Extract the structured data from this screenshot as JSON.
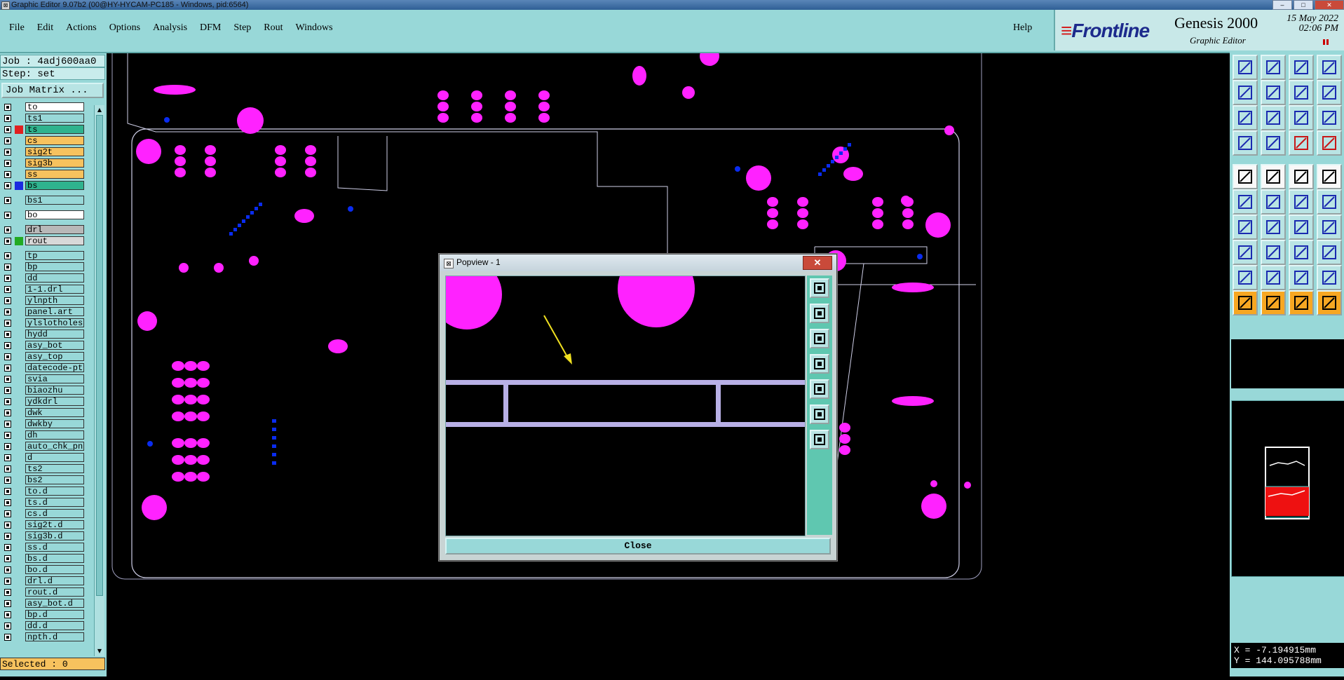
{
  "window": {
    "title": "Graphic Editor 9.07b2 (00@HY-HYCAM-PC185 - Windows, pid:6564)",
    "controls": [
      "–",
      "□",
      "✕"
    ]
  },
  "menu": {
    "items": [
      "File",
      "Edit",
      "Actions",
      "Options",
      "Analysis",
      "DFM",
      "Step",
      "Rout",
      "Windows"
    ],
    "help": "Help"
  },
  "brand": {
    "logo": "Frontline",
    "product": "Genesis 2000",
    "subtitle": "Graphic Editor",
    "date": "15 May 2022",
    "time": "02:06 PM"
  },
  "left": {
    "job": "Job : 4adj600aa0",
    "step": "Step: set",
    "job_matrix": "Job Matrix ...",
    "selected": "Selected : 0",
    "layers": [
      {
        "name": "to",
        "color": "",
        "bg": "#ffffff"
      },
      {
        "name": "ts1",
        "color": "",
        "bg": "#98d8d8"
      },
      {
        "name": "ts",
        "color": "#e02020",
        "bg": "#2fb38e"
      },
      {
        "name": "cs",
        "color": "",
        "bg": "#f7c25e"
      },
      {
        "name": "sig2t",
        "color": "",
        "bg": "#f7c25e"
      },
      {
        "name": "sig3b",
        "color": "",
        "bg": "#f7c25e"
      },
      {
        "name": "ss",
        "color": "",
        "bg": "#f7c25e"
      },
      {
        "name": "bs",
        "color": "#1a2ae0",
        "bg": "#2fb38e"
      },
      {
        "name": "bs1",
        "color": "",
        "bg": "#98d8d8"
      },
      {
        "name": "bo",
        "color": "",
        "bg": "#ffffff"
      },
      {
        "name": "drl",
        "color": "",
        "bg": "#b8b8b8"
      },
      {
        "name": "rout",
        "color": "#22aa22",
        "bg": "#d8d8d8"
      },
      {
        "name": "tp",
        "color": "",
        "bg": "#98d8d8"
      },
      {
        "name": "bp",
        "color": "",
        "bg": "#98d8d8"
      },
      {
        "name": "dd",
        "color": "",
        "bg": "#98d8d8"
      },
      {
        "name": "1-1.drl",
        "color": "",
        "bg": "#98d8d8"
      },
      {
        "name": "ylnpth",
        "color": "",
        "bg": "#98d8d8"
      },
      {
        "name": "panel.art",
        "color": "",
        "bg": "#98d8d8"
      },
      {
        "name": "ylslotholes",
        "color": "",
        "bg": "#98d8d8"
      },
      {
        "name": "hydd",
        "color": "",
        "bg": "#98d8d8"
      },
      {
        "name": "asy_bot",
        "color": "",
        "bg": "#98d8d8"
      },
      {
        "name": "asy_top",
        "color": "",
        "bg": "#98d8d8"
      },
      {
        "name": "datecode-pte",
        "color": "",
        "bg": "#98d8d8"
      },
      {
        "name": "svia",
        "color": "",
        "bg": "#98d8d8"
      },
      {
        "name": "biaozhu",
        "color": "",
        "bg": "#98d8d8"
      },
      {
        "name": "ydkdrl",
        "color": "",
        "bg": "#98d8d8"
      },
      {
        "name": "dwk",
        "color": "",
        "bg": "#98d8d8"
      },
      {
        "name": "dwkby",
        "color": "",
        "bg": "#98d8d8"
      },
      {
        "name": "dh",
        "color": "",
        "bg": "#98d8d8"
      },
      {
        "name": "auto_chk_pn",
        "color": "",
        "bg": "#98d8d8"
      },
      {
        "name": "d",
        "color": "",
        "bg": "#98d8d8"
      },
      {
        "name": "ts2",
        "color": "",
        "bg": "#98d8d8"
      },
      {
        "name": "bs2",
        "color": "",
        "bg": "#98d8d8"
      },
      {
        "name": "to.d",
        "color": "",
        "bg": "#98d8d8"
      },
      {
        "name": "ts.d",
        "color": "",
        "bg": "#98d8d8"
      },
      {
        "name": "cs.d",
        "color": "",
        "bg": "#98d8d8"
      },
      {
        "name": "sig2t.d",
        "color": "",
        "bg": "#98d8d8"
      },
      {
        "name": "sig3b.d",
        "color": "",
        "bg": "#98d8d8"
      },
      {
        "name": "ss.d",
        "color": "",
        "bg": "#98d8d8"
      },
      {
        "name": "bs.d",
        "color": "",
        "bg": "#98d8d8"
      },
      {
        "name": "bo.d",
        "color": "",
        "bg": "#98d8d8"
      },
      {
        "name": "drl.d",
        "color": "",
        "bg": "#98d8d8"
      },
      {
        "name": "rout.d",
        "color": "",
        "bg": "#98d8d8"
      },
      {
        "name": "asy_bot.d",
        "color": "",
        "bg": "#98d8d8"
      },
      {
        "name": "bp.d",
        "color": "",
        "bg": "#98d8d8"
      },
      {
        "name": "dd.d",
        "color": "",
        "bg": "#98d8d8"
      },
      {
        "name": "npth.d",
        "color": "",
        "bg": "#98d8d8"
      }
    ]
  },
  "popup": {
    "title": "Popview - 1",
    "close_x": "✕",
    "close_button": "Close"
  },
  "coords": {
    "x": "X = -7.194915mm",
    "y": "Y = 144.095788mm"
  },
  "colors": {
    "pad": "#ff22ff",
    "via": "#0a2cf0",
    "outline": "#cfcfe8",
    "route": "#b8b0e6",
    "arrow": "#f0e020",
    "panel": "#98d8d8",
    "highlight_orange": "#f7a722"
  }
}
